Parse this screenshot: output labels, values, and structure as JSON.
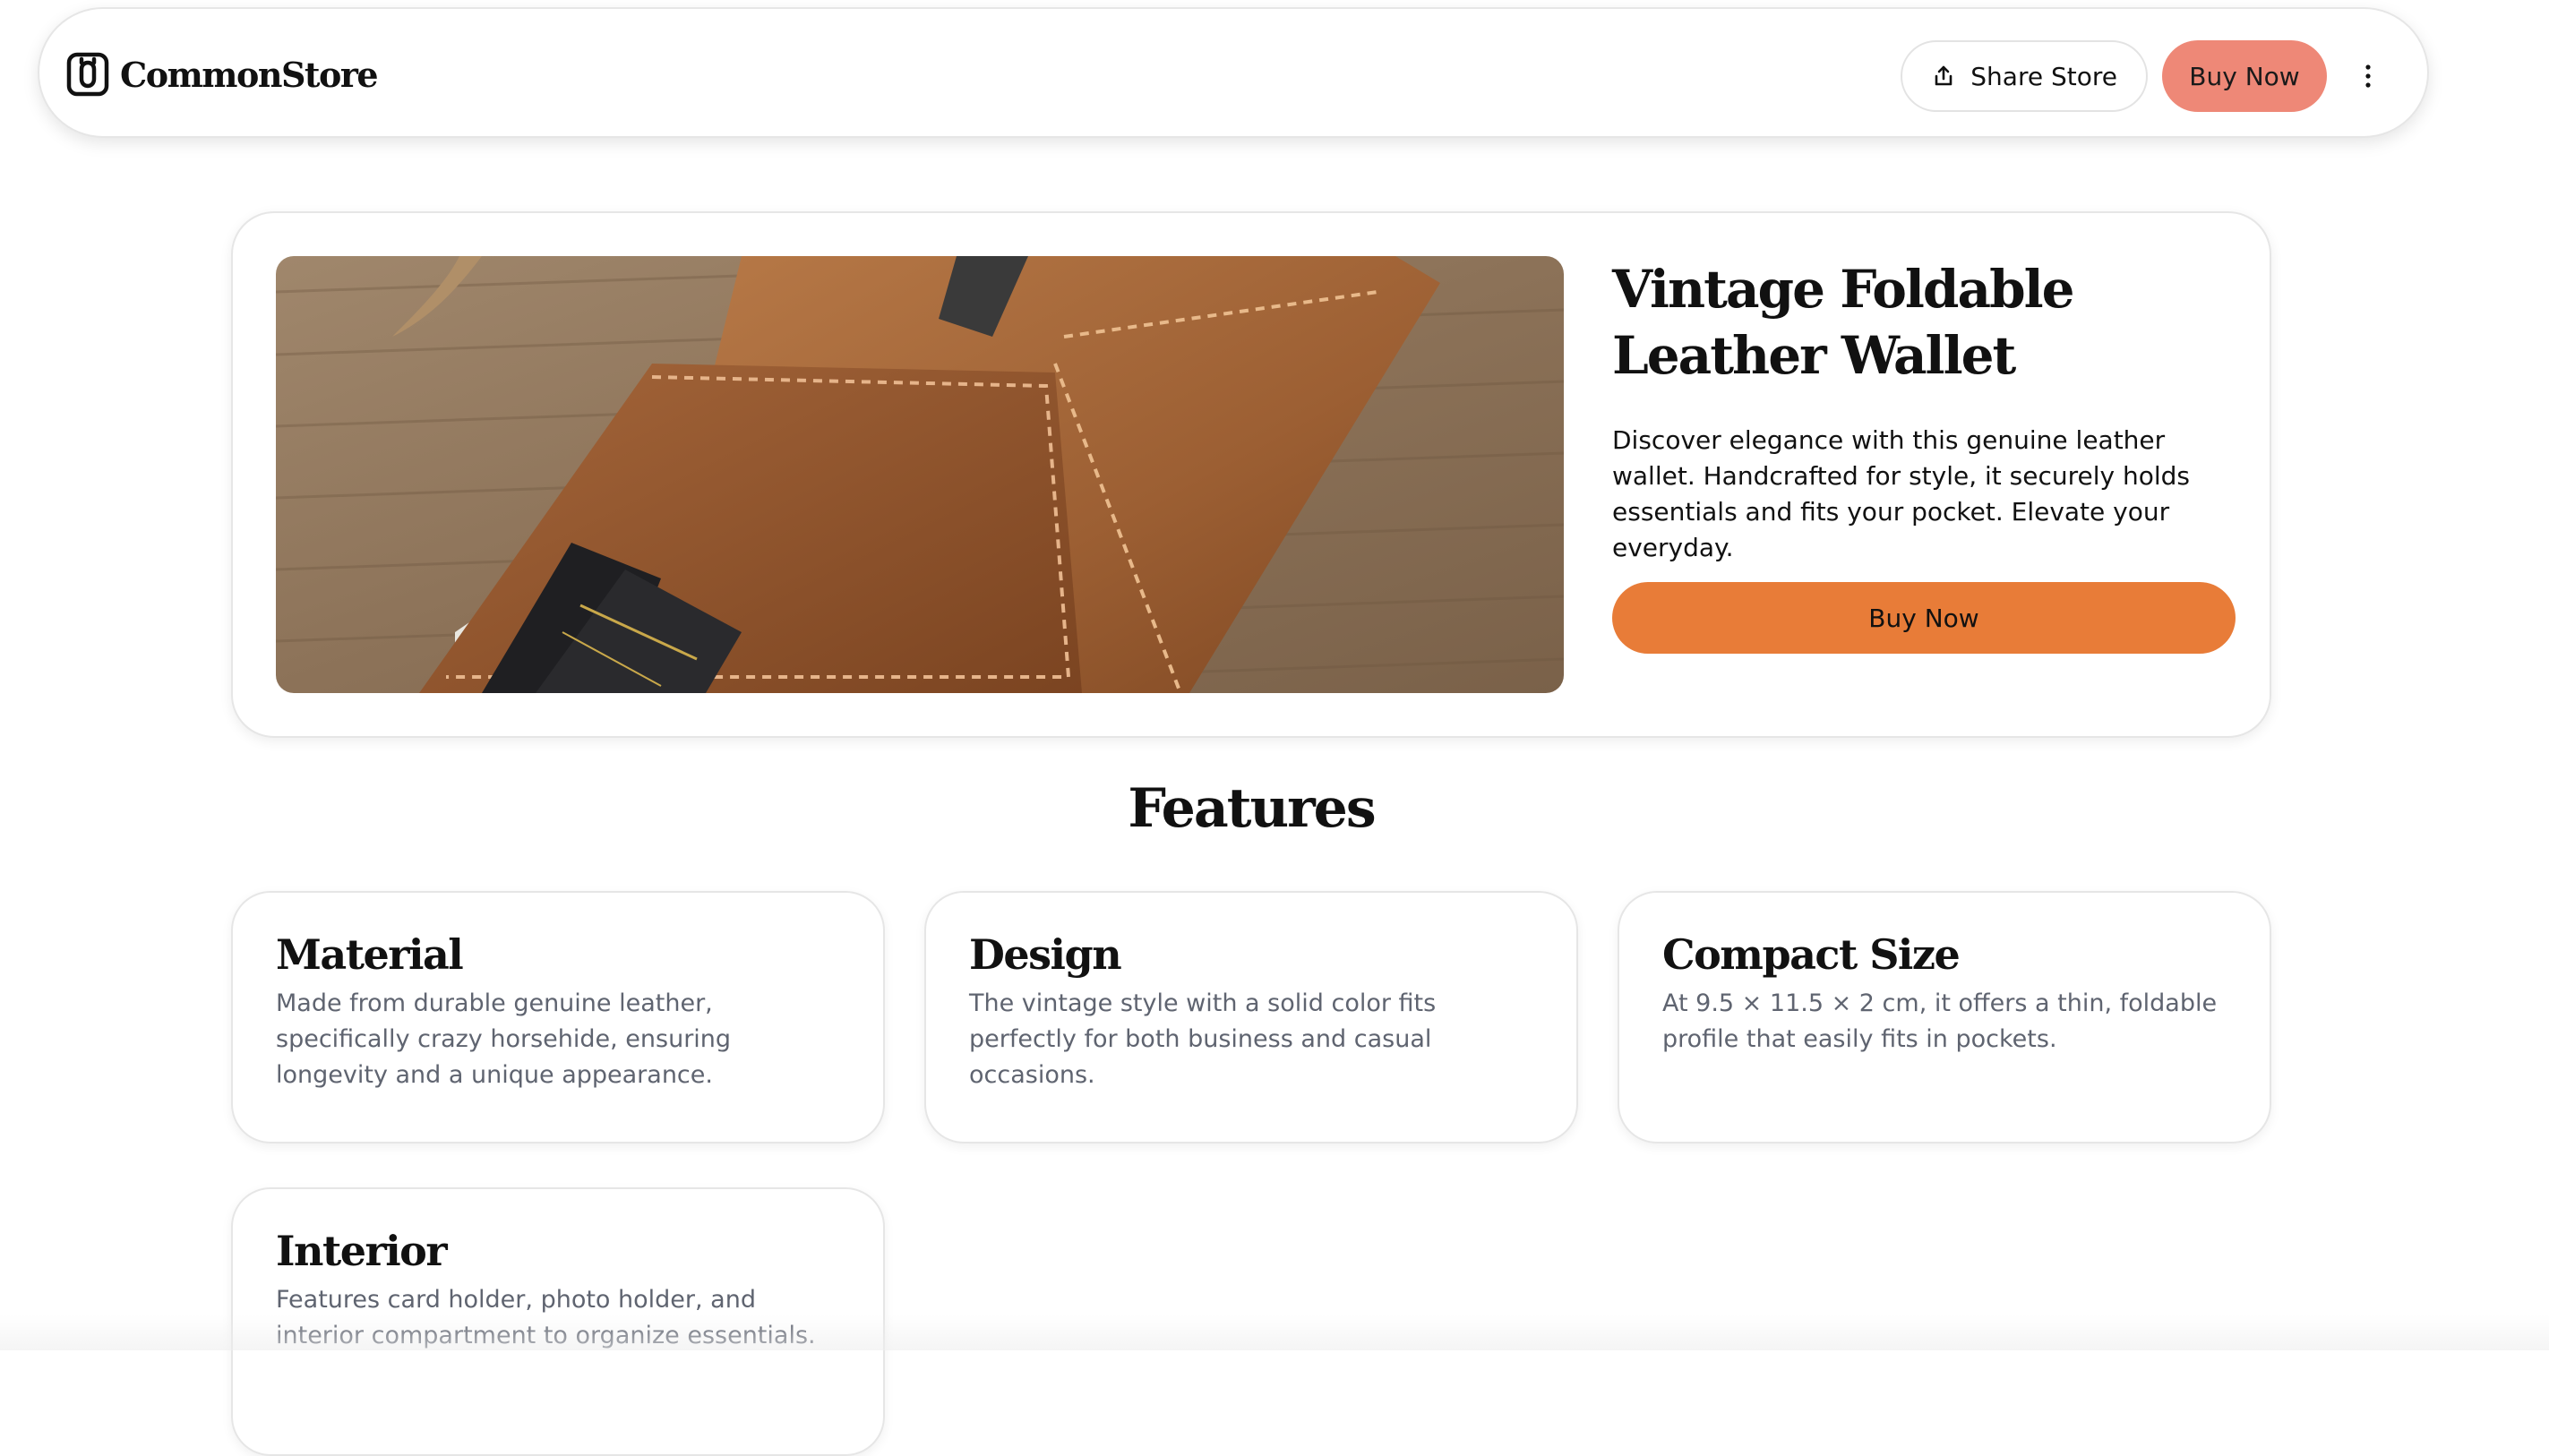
{
  "header": {
    "brand_name": "CommonStore",
    "logo_icon": "commonstore-logo-icon",
    "share_label": "Share Store",
    "share_icon": "share-upload-icon",
    "buy_label": "Buy Now",
    "more_icon": "vertical-ellipsis-icon",
    "buy_color": "#ee8877"
  },
  "product": {
    "image_icon": "leather-wallet-photo",
    "title": "Vintage Foldable Leather Wallet",
    "description": "Discover elegance with this genuine leather wallet. Handcrafted for style, it securely holds essentials and fits your pocket. Elevate your everyday.",
    "buy_label": "Buy Now",
    "buy_color": "#e87c38"
  },
  "features": {
    "heading": "Features",
    "items": [
      {
        "title": "Material",
        "description": "Made from durable genuine leather, specifically crazy horsehide, ensuring longevity and a unique appearance."
      },
      {
        "title": "Design",
        "description": "The vintage style with a solid color fits perfectly for both business and casual occasions."
      },
      {
        "title": "Compact Size",
        "description": "At 9.5 × 11.5 × 2 cm, it offers a thin, foldable profile that easily fits in pockets."
      },
      {
        "title": "Interior",
        "description": "Features card holder, photo holder, and interior compartment to organize essentials."
      }
    ]
  }
}
